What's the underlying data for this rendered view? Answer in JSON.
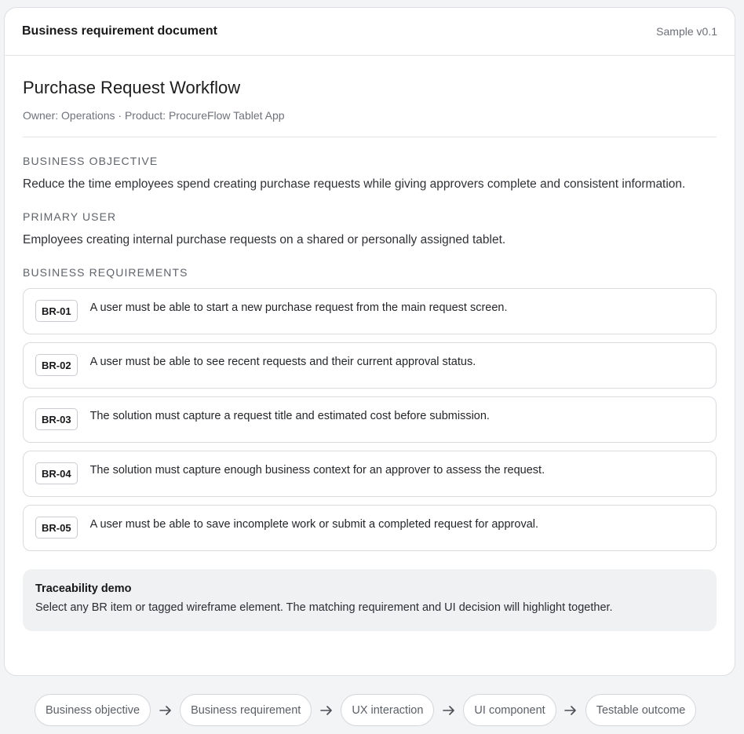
{
  "header": {
    "title": "Business requirement document",
    "version": "Sample v0.1"
  },
  "document": {
    "title": "Purchase Request Workflow",
    "meta": "Owner: Operations · Product: ProcureFlow Tablet App"
  },
  "sections": {
    "objective": {
      "label": "BUSINESS OBJECTIVE",
      "text": "Reduce the time employees spend creating purchase requests while giving approvers complete and consistent information."
    },
    "primary_user": {
      "label": "PRIMARY USER",
      "text": "Employees creating internal purchase requests on a shared or personally assigned tablet."
    },
    "requirements_label": "BUSINESS REQUIREMENTS"
  },
  "requirements": [
    {
      "id": "BR-01",
      "text": "A user must be able to start a new purchase request from the main request screen."
    },
    {
      "id": "BR-02",
      "text": "A user must be able to see recent requests and their current approval status."
    },
    {
      "id": "BR-03",
      "text": "The solution must capture a request title and estimated cost before submission."
    },
    {
      "id": "BR-04",
      "text": "The solution must capture enough business context for an approver to assess the request."
    },
    {
      "id": "BR-05",
      "text": "A user must be able to save incomplete work or submit a completed request for approval."
    }
  ],
  "traceability": {
    "title": "Traceability demo",
    "text": "Select any BR item or tagged wireframe element. The matching requirement and UI decision will highlight together."
  },
  "flow": [
    "Business objective",
    "Business requirement",
    "UX interaction",
    "UI component",
    "Testable outcome"
  ],
  "icons": {
    "flow_separator": "arrow-right-icon"
  },
  "colors": {
    "page_bg": "#f3f4f5",
    "card_bg": "#ffffff",
    "border": "#d9dbdf",
    "trace_bg": "#f0f1f2"
  }
}
